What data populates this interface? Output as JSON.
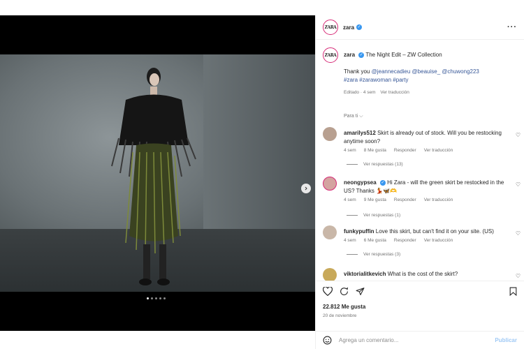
{
  "post": {
    "username": "zara",
    "logo_text": "ZARA",
    "caption_title": "The Night Edit – ZW Collection",
    "caption_thanks": "Thank you",
    "mentions": [
      "@jeannecadieu",
      "@beauise_",
      "@chuwong223"
    ],
    "hashtags": [
      "#zara",
      "#zarawoman",
      "#party"
    ],
    "caption_meta": "Editado · 4 sem",
    "see_translation": "Ver traducción",
    "for_you": "Para ti",
    "likes": "22.812 Me gusta",
    "date": "20 de noviembre",
    "carousel_count": 5
  },
  "comments": [
    {
      "user": "amarilys512",
      "text": "Skirt is already out of stock. Will you be restocking anytime soon?",
      "time": "4 sem",
      "likes": "8 Me gusta",
      "reply": "Responder",
      "translate": "Ver traducción",
      "replies": "Ver respuestas (13)"
    },
    {
      "user": "neongypsea",
      "verified": true,
      "text": "Hi Zara - will the green skirt be restocked in the US? Thanks 💃🦋🫶",
      "time": "4 sem",
      "likes": "9 Me gusta",
      "reply": "Responder",
      "translate": "Ver traducción",
      "replies": "Ver respuestas (1)"
    },
    {
      "user": "funkypuffin",
      "text": "Love this skirt, but can't find it on your site. (US)",
      "time": "4 sem",
      "likes": "6 Me gusta",
      "reply": "Responder",
      "translate": "Ver traducción",
      "replies": "Ver respuestas (3)"
    },
    {
      "user": "viktorialitkevich",
      "text": "What is the cost of the skirt?"
    }
  ],
  "composer": {
    "placeholder": "Agrega un comentario...",
    "publish": "Publicar"
  },
  "colors": {
    "accent": "#3897f0",
    "link": "#385898",
    "publish": "#9fc9f5"
  }
}
